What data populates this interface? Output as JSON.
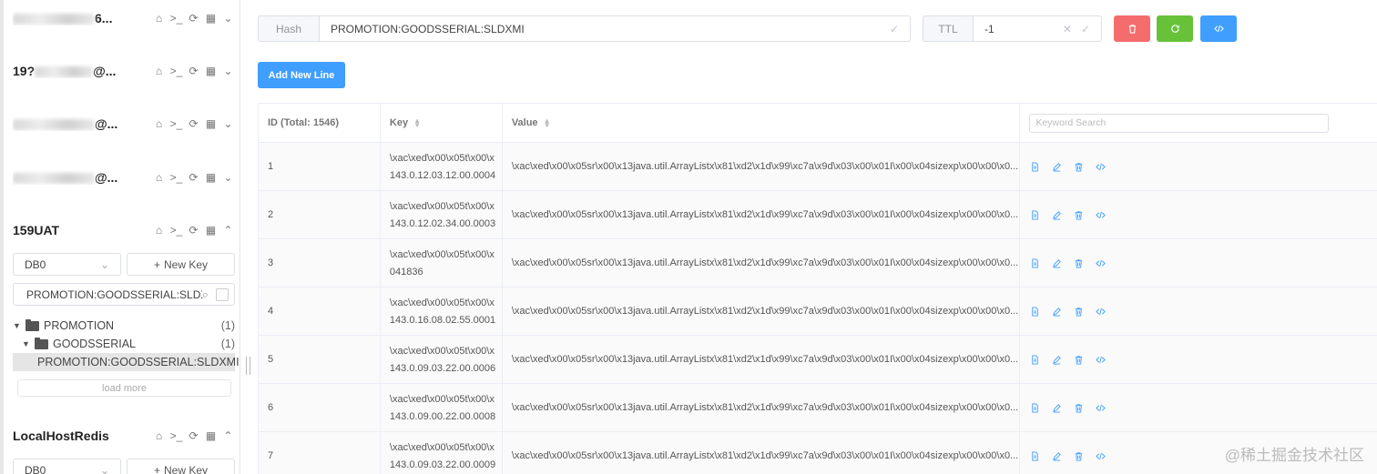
{
  "sidebar": {
    "connections": [
      {
        "name_suffix": "6...",
        "collapsed": true
      },
      {
        "name_prefix": "19?",
        "name_suffix": "@...",
        "collapsed": true
      },
      {
        "name_suffix": "@...",
        "collapsed": true
      },
      {
        "name_suffix": "@...",
        "collapsed": true
      },
      {
        "name": "159UAT",
        "expanded": true
      },
      {
        "name": "LocalHostRedis",
        "expanded": true
      }
    ],
    "db_select": "DB0",
    "new_key_label": "New Key",
    "search_value": "PROMOTION:GOODSSERIAL:SLDXMI",
    "tree": [
      {
        "label": "PROMOTION",
        "count": "(1)"
      },
      {
        "label": "GOODSSERIAL",
        "count": "(1)"
      },
      {
        "label": "PROMOTION:GOODSSERIAL:SLDXMI"
      }
    ],
    "load_more": "load more",
    "second_db_select": "DB0",
    "second_new_key_label": "New Key"
  },
  "keybar": {
    "type_label": "Hash",
    "key_name": "PROMOTION:GOODSSERIAL:SLDXMI",
    "ttl_label": "TTL",
    "ttl_value": "-1"
  },
  "actions": {
    "add_line": "Add New Line",
    "colors": {
      "delete": "#f56c6c",
      "refresh": "#67c23a",
      "code": "#409eff"
    }
  },
  "table": {
    "headers": {
      "id": "ID (Total: 1546)",
      "key": "Key",
      "value": "Value"
    },
    "keyword_placeholder": "Keyword Search",
    "rows": [
      {
        "id": "1",
        "key1": "\\xac\\xed\\x00\\x05t\\x00\\x",
        "key2": "143.0.12.03.12.00.0004",
        "value": "\\xac\\xed\\x00\\x05sr\\x00\\x13java.util.ArrayListx\\x81\\xd2\\x1d\\x99\\xc7a\\x9d\\x03\\x00\\x01I\\x00\\x04sizexp\\x00\\x00\\x0..."
      },
      {
        "id": "2",
        "key1": "\\xac\\xed\\x00\\x05t\\x00\\x",
        "key2": "143.0.12.02.34.00.0003",
        "value": "\\xac\\xed\\x00\\x05sr\\x00\\x13java.util.ArrayListx\\x81\\xd2\\x1d\\x99\\xc7a\\x9d\\x03\\x00\\x01I\\x00\\x04sizexp\\x00\\x00\\x0..."
      },
      {
        "id": "3",
        "key1": "\\xac\\xed\\x00\\x05t\\x00\\x",
        "key2": "041836",
        "value": "\\xac\\xed\\x00\\x05sr\\x00\\x13java.util.ArrayListx\\x81\\xd2\\x1d\\x99\\xc7a\\x9d\\x03\\x00\\x01I\\x00\\x04sizexp\\x00\\x00\\x0..."
      },
      {
        "id": "4",
        "key1": "\\xac\\xed\\x00\\x05t\\x00\\x",
        "key2": "143.0.16.08.02.55.0001",
        "value": "\\xac\\xed\\x00\\x05sr\\x00\\x13java.util.ArrayListx\\x81\\xd2\\x1d\\x99\\xc7a\\x9d\\x03\\x00\\x01I\\x00\\x04sizexp\\x00\\x00\\x0..."
      },
      {
        "id": "5",
        "key1": "\\xac\\xed\\x00\\x05t\\x00\\x",
        "key2": "143.0.09.03.22.00.0006",
        "value": "\\xac\\xed\\x00\\x05sr\\x00\\x13java.util.ArrayListx\\x81\\xd2\\x1d\\x99\\xc7a\\x9d\\x03\\x00\\x01I\\x00\\x04sizexp\\x00\\x00\\x0..."
      },
      {
        "id": "6",
        "key1": "\\xac\\xed\\x00\\x05t\\x00\\x",
        "key2": "143.0.09.00.22.00.0008",
        "value": "\\xac\\xed\\x00\\x05sr\\x00\\x13java.util.ArrayListx\\x81\\xd2\\x1d\\x99\\xc7a\\x9d\\x03\\x00\\x01I\\x00\\x04sizexp\\x00\\x00\\x0..."
      },
      {
        "id": "7",
        "key1": "\\xac\\xed\\x00\\x05t\\x00\\x",
        "key2": "143.0.09.03.22.00.0009",
        "value": "\\xac\\xed\\x00\\x05sr\\x00\\x13java.util.ArrayListx\\x81\\xd2\\x1d\\x99\\xc7a\\x9d\\x03\\x00\\x01I\\x00\\x04sizexp\\x00\\x00\\x0..."
      }
    ]
  },
  "watermark": "@稀土掘金技术社区"
}
